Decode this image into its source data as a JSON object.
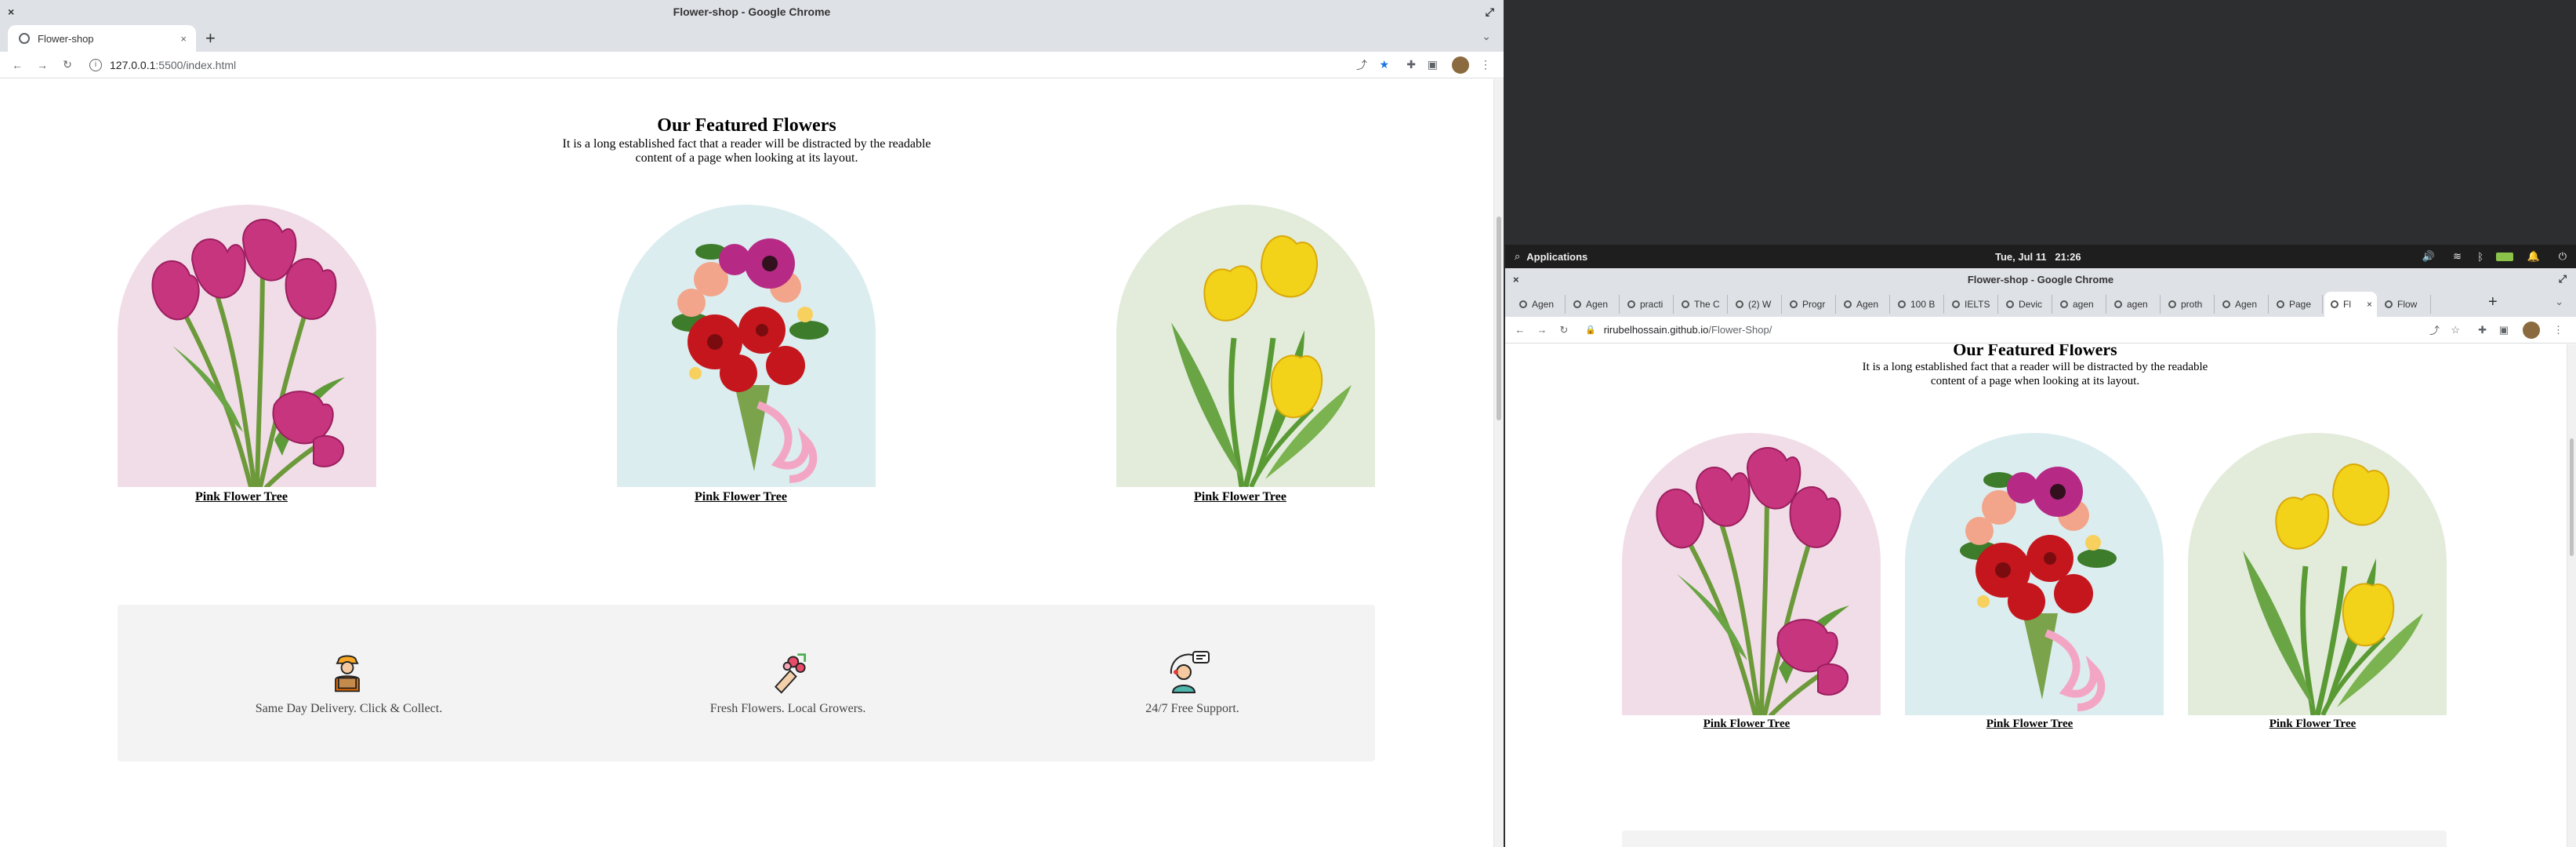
{
  "left_window": {
    "title": "Flower-shop - Google Chrome",
    "tab_label": "Flower-shop",
    "url_host": "127.0.0.1",
    "url_path": ":5500/index.html"
  },
  "right_window": {
    "title": "Flower-shop - Google Chrome",
    "url_host": "rirubelhossain.github.io",
    "url_path": "/Flower-Shop/",
    "tabs": [
      "Agen",
      "Agen",
      "practi",
      "The C",
      "(2) W",
      "Progr",
      "Agen",
      "100 B",
      "IELTS",
      "Devic",
      "agen",
      "agen",
      "proth",
      "Agen",
      "Page",
      "Fl",
      "Flow"
    ]
  },
  "desktop": {
    "apps_label": "Applications",
    "datetime": "Tue, Jul 11   21:26"
  },
  "page": {
    "heading": "Our Featured Flowers",
    "subtitle_line1": "It is a long established fact that a reader will be distracted by the readable",
    "subtitle_line2": "content of a page when looking at its layout.",
    "cards": [
      {
        "caption": "Pink Flower Tree",
        "bg": "#f1dde8",
        "flower": "pink-tulips"
      },
      {
        "caption": "Pink Flower Tree",
        "bg": "#dcedf0",
        "flower": "bouquet"
      },
      {
        "caption": "Pink Flower Tree",
        "bg": "#e3ecdb",
        "flower": "yellow-tulips"
      }
    ],
    "features": [
      {
        "text": "Same Day Delivery. Click & Collect.",
        "icon": "delivery-person-icon"
      },
      {
        "text": "Fresh Flowers. Local Growers.",
        "icon": "flower-bouquet-icon"
      },
      {
        "text": "24/7 Free Support.",
        "icon": "support-agent-icon"
      }
    ]
  },
  "colors": {
    "tulip_pink": "#c7357f",
    "tulip_yellow": "#f3d21a",
    "stem_green": "#5a9a35",
    "chrome_bg": "#dee1e6",
    "accent_blue": "#1a73e8"
  }
}
